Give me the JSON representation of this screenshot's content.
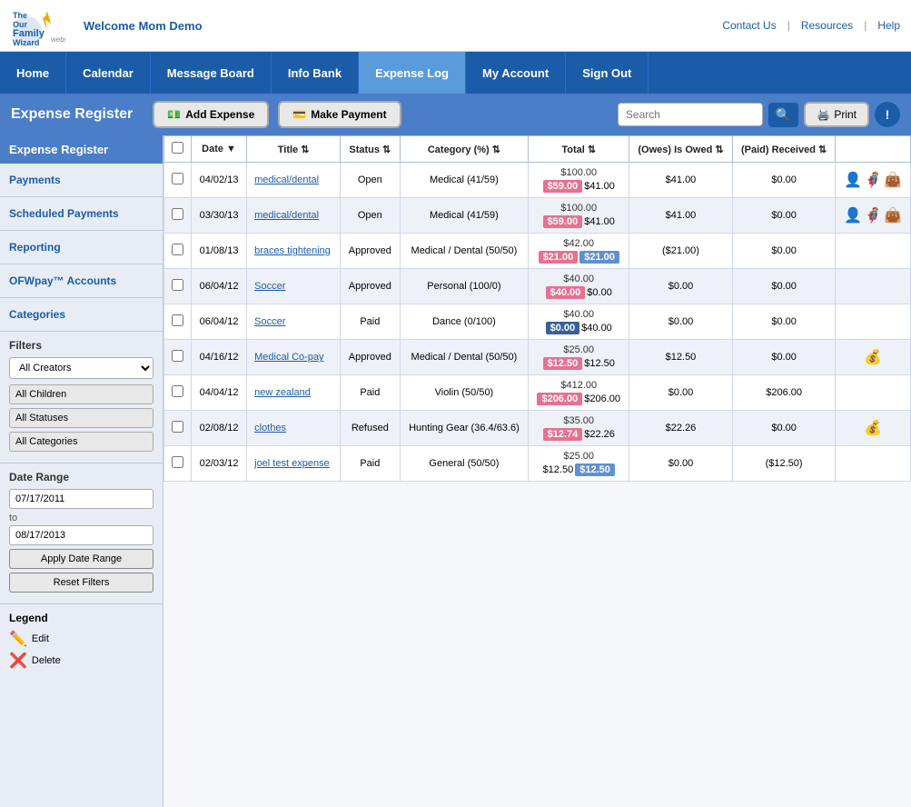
{
  "topbar": {
    "welcome": "Welcome Mom Demo",
    "links": [
      "Contact Us",
      "Resources",
      "Help"
    ]
  },
  "nav": {
    "items": [
      "Home",
      "Calendar",
      "Message Board",
      "Info Bank",
      "Expense Log",
      "My Account",
      "Sign Out"
    ],
    "active": "Expense Log"
  },
  "subheader": {
    "title": "Expense Register",
    "btn_add": "Add Expense",
    "btn_pay": "Make Payment",
    "search_placeholder": "Search",
    "btn_print": "Print"
  },
  "sidebar": {
    "header": "Expense Register",
    "links": [
      "Payments",
      "Scheduled Payments",
      "Reporting",
      "OFWpay™ Accounts",
      "Categories"
    ],
    "filters_label": "Filters",
    "filter_creators": "All Creators",
    "filter_children": "All Children",
    "filter_statuses": "All Statuses",
    "filter_categories": "All Categories",
    "date_range_label": "Date Range",
    "date_from": "07/17/2011",
    "date_to_label": "to",
    "date_to": "08/17/2013",
    "btn_apply": "Apply Date Range",
    "btn_reset": "Reset Filters",
    "legend_label": "Legend",
    "legend_items": [
      {
        "icon": "✏️",
        "label": "Edit"
      },
      {
        "icon": "❌",
        "label": "Delete"
      }
    ]
  },
  "table": {
    "columns": [
      "",
      "Date",
      "Title",
      "Status",
      "Category (%)",
      "Total",
      "(Owes) Is Owed",
      "(Paid) Received",
      ""
    ],
    "rows": [
      {
        "date": "04/02/13",
        "title": "medical/dental",
        "status": "Open",
        "category": "Medical (41/59)",
        "total_main": "$100.00",
        "total_pink": "$59.00",
        "total_normal": "$41.00",
        "owes": "$41.00",
        "paid": "$0.00",
        "icons": [
          "👨‍💼",
          "🦸",
          "💼"
        ]
      },
      {
        "date": "03/30/13",
        "title": "medical/dental",
        "status": "Open",
        "category": "Medical (41/59)",
        "total_main": "$100.00",
        "total_pink": "$59.00",
        "total_normal": "$41.00",
        "owes": "$41.00",
        "paid": "$0.00",
        "icons": [
          "👨‍💼",
          "🦸",
          "💼"
        ]
      },
      {
        "date": "01/08/13",
        "title": "braces tightening",
        "status": "Approved",
        "category": "Medical / Dental (50/50)",
        "total_main": "$42.00",
        "total_pink": "$21.00",
        "total_blue": "$21.00",
        "owes": "($21.00)",
        "paid": "$0.00",
        "icons": []
      },
      {
        "date": "06/04/12",
        "title": "Soccer",
        "status": "Approved",
        "category": "Personal (100/0)",
        "total_main": "$40.00",
        "total_pink": "$40.00",
        "total_normal": "$0.00",
        "owes": "$0.00",
        "paid": "$0.00",
        "icons": []
      },
      {
        "date": "06/04/12",
        "title": "Soccer",
        "status": "Paid",
        "category": "Dance (0/100)",
        "total_main": "$40.00",
        "total_dark": "$0.00",
        "total_normal": "$40.00",
        "owes": "$0.00",
        "paid": "$0.00",
        "icons": []
      },
      {
        "date": "04/16/12",
        "title": "Medical Co-pay",
        "status": "Approved",
        "category": "Medical / Dental (50/50)",
        "total_main": "$25.00",
        "total_pink": "$12.50",
        "total_normal": "$12.50",
        "owes": "$12.50",
        "paid": "$0.00",
        "icons": [
          "💰"
        ]
      },
      {
        "date": "04/04/12",
        "title": "new zealand",
        "status": "Paid",
        "category": "Violin (50/50)",
        "total_main": "$412.00",
        "total_pink": "$206.00",
        "total_normal": "$206.00",
        "owes": "$0.00",
        "paid": "$206.00",
        "icons": []
      },
      {
        "date": "02/08/12",
        "title": "clothes",
        "status": "Refused",
        "category": "Hunting Gear (36.4/63.6)",
        "total_main": "$35.00",
        "total_pink": "$12.74",
        "total_normal": "$22.26",
        "owes": "$22.26",
        "paid": "$0.00",
        "icons": [
          "💰"
        ]
      },
      {
        "date": "02/03/12",
        "title": "joel test expense",
        "status": "Paid",
        "category": "General (50/50)",
        "total_main": "$25.00",
        "total_normal": "$12.50",
        "total_blue": "$12.50",
        "owes": "$0.00",
        "paid": "($12.50)",
        "icons": []
      }
    ]
  }
}
